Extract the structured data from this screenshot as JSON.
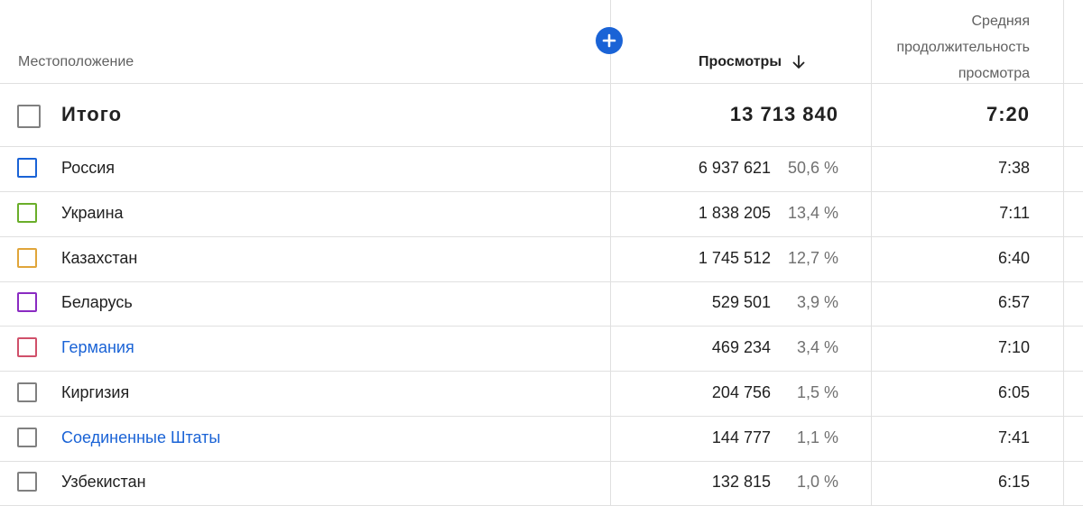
{
  "header": {
    "location_label": "Местоположение",
    "views_label": "Просмотры",
    "duration_label": "Средняя продолжительность просмотра",
    "add_icon": "plus-circle-icon",
    "sort_icon": "arrow-down-icon"
  },
  "colors": {
    "accent": "#1a63d6",
    "divider": "#e0e0e0"
  },
  "total": {
    "label": "Итого",
    "views": "13 713 840",
    "duration": "7:20",
    "checkbox_color": "#808080"
  },
  "rows": [
    {
      "name": "Россия",
      "views": "6 937 621",
      "pct": "50,6 %",
      "duration": "7:38",
      "color": "#1a63d6",
      "link": false
    },
    {
      "name": "Украина",
      "views": "1 838 205",
      "pct": "13,4 %",
      "duration": "7:11",
      "color": "#6aae2a",
      "link": false
    },
    {
      "name": "Казахстан",
      "views": "1 745 512",
      "pct": "12,7 %",
      "duration": "6:40",
      "color": "#e0a53a",
      "link": false
    },
    {
      "name": "Беларусь",
      "views": "529 501",
      "pct": "3,9 %",
      "duration": "6:57",
      "color": "#8a2bc2",
      "link": false
    },
    {
      "name": "Германия",
      "views": "469 234",
      "pct": "3,4 %",
      "duration": "7:10",
      "color": "#d0506a",
      "link": true
    },
    {
      "name": "Киргизия",
      "views": "204 756",
      "pct": "1,5 %",
      "duration": "6:05",
      "color": "#808080",
      "link": false
    },
    {
      "name": "Соединенные Штаты",
      "views": "144 777",
      "pct": "1,1 %",
      "duration": "7:41",
      "color": "#808080",
      "link": true
    },
    {
      "name": "Узбекистан",
      "views": "132 815",
      "pct": "1,0 %",
      "duration": "6:15",
      "color": "#808080",
      "link": false
    }
  ]
}
